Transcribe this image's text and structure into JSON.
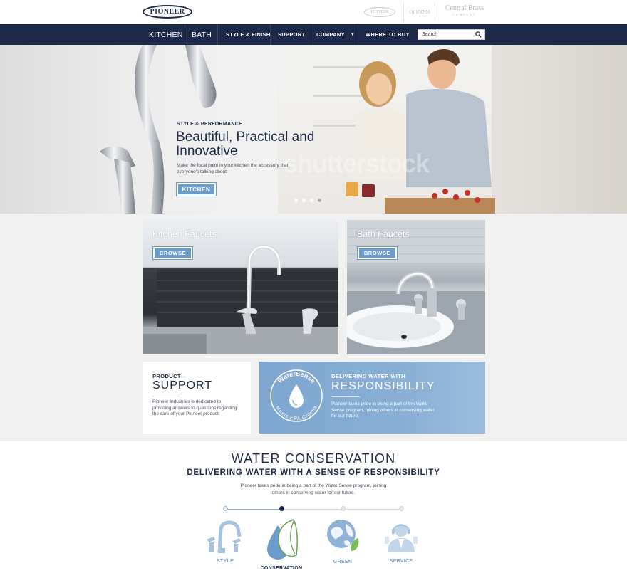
{
  "brands": {
    "main_logo": "PIONEER",
    "alt_logos": [
      {
        "name": "PIONEER"
      },
      {
        "name": "OLYMPIA"
      },
      {
        "name": "Central Brass",
        "tagline": "COMPANY"
      }
    ]
  },
  "nav": {
    "items": [
      "KITCHEN",
      "BATH",
      "STYLE & FINISH",
      "SUPPORT",
      "COMPANY",
      "WHERE TO BUY"
    ],
    "search_placeholder": "Search"
  },
  "hero": {
    "kicker": "STYLE & PERFORMANCE",
    "title": "Beautiful, Practical and Innovative",
    "description": "Make the focal point in your kitchen the accessory that everyone's talking about.",
    "button": "KITCHEN",
    "watermark": "shutterstock",
    "slides": 4,
    "active_slide": 4
  },
  "tiles": [
    {
      "title": "Kitchen Faucets",
      "button": "BROWSE"
    },
    {
      "title": "Bath Faucets",
      "button": "BROWSE"
    }
  ],
  "support": {
    "kicker": "PRODUCT",
    "title": "SUPPORT",
    "text": "Pioneer Industries is dedicated to providing answers to questions regarding the care of your Pioneer product."
  },
  "watersense": {
    "seal_top": "WaterSense",
    "seal_bottom": "Meets EPA Criteria",
    "kicker": "DELIVERING WATER WITH",
    "title": "RESPONSIBILITY",
    "text": "Pioneer takes pride in being a part of the Water Sense program, joining others in conserving water for our future."
  },
  "conservation": {
    "title": "WATER CONSERVATION",
    "subtitle": "DELIVERING WATER WITH A SENSE OF RESPONSIBILITY",
    "description": "Pioneer takes pride in being a part of the Water Sense program, joining others in conserving water for our future.",
    "features": [
      {
        "label": "STYLE",
        "icon": "faucet-icon",
        "active": false
      },
      {
        "label": "CONSERVATION",
        "icon": "water-drop-leaf-icon",
        "active": true
      },
      {
        "label": "GREEN",
        "icon": "globe-leaf-icon",
        "active": false
      },
      {
        "label": "SERVICE",
        "icon": "service-person-icon",
        "active": false
      }
    ]
  },
  "colors": {
    "navy": "#1c2948",
    "accent_blue": "#6b9cca",
    "light_blue": "#8fb3d7",
    "inactive_grey": "#d0d3d8"
  }
}
